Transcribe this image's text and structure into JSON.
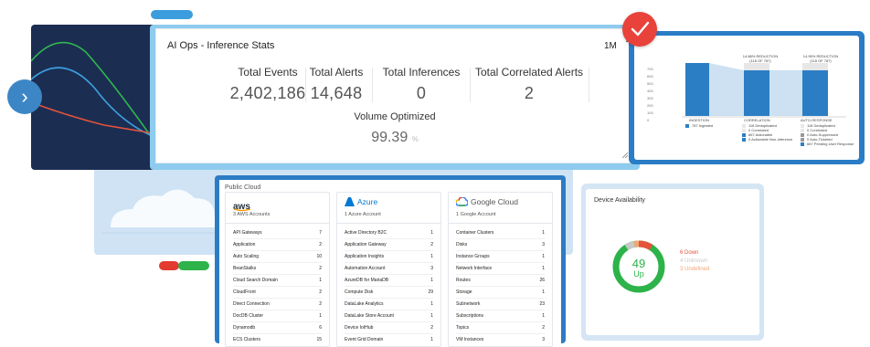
{
  "aiops": {
    "title": "AI Ops - Inference Stats",
    "range": "1M",
    "stats": [
      {
        "label": "Total Events",
        "value": "2,402,186"
      },
      {
        "label": "Total Alerts",
        "value": "14,648"
      },
      {
        "label": "Total Inferences",
        "value": "0"
      },
      {
        "label": "Total Correlated Alerts",
        "value": "2"
      }
    ],
    "volume_label": "Volume Optimized",
    "volume_value": "99.39",
    "volume_unit": "%"
  },
  "reduction": {
    "headers": [
      "14.88% REDUCTION",
      "14.95% REDUCTION"
    ],
    "subheaders": [
      "(118 OF 787)",
      "(118 OF 787)"
    ],
    "yticks": [
      "700",
      "600",
      "500",
      "400",
      "300",
      "200",
      "100",
      "0"
    ],
    "columns": [
      "INGESTION",
      "CORRELATION",
      "AUTO-RESPONSE"
    ],
    "legend_ingestion": [
      "787 Ingested"
    ],
    "legend_correlation": [
      "118 Deduplicated",
      "0 Correlated",
      "667 Actionable",
      "0 Actionable Non-Inference"
    ],
    "legend_auto": [
      "118 Deduplicated",
      "0 Correlated",
      "0 Auto-Suppressed",
      "0 Auto-Ticketed",
      "667 Pending User Response"
    ]
  },
  "public_cloud": {
    "title": "Public Cloud",
    "providers": [
      {
        "logo_text": "aws",
        "account": "3 AWS Accounts",
        "rows": [
          {
            "name": "API Gateways",
            "count": "7"
          },
          {
            "name": "Application",
            "count": "2"
          },
          {
            "name": "Auto Scaling",
            "count": "10"
          },
          {
            "name": "BeanStalks",
            "count": "2"
          },
          {
            "name": "Cloud Search Domain",
            "count": "1"
          },
          {
            "name": "CloudFront",
            "count": "2"
          },
          {
            "name": "Direct Connection",
            "count": "2"
          },
          {
            "name": "DocDB Cluster",
            "count": "1"
          },
          {
            "name": "Dynamodb",
            "count": "6"
          },
          {
            "name": "ECS Clusters",
            "count": "15"
          }
        ]
      },
      {
        "logo_text": "Azure",
        "account": "1 Azure Account",
        "rows": [
          {
            "name": "Active Directory B2C",
            "count": "1"
          },
          {
            "name": "Application Gateway",
            "count": "2"
          },
          {
            "name": "Application Insights",
            "count": "1"
          },
          {
            "name": "Automation Account",
            "count": "3"
          },
          {
            "name": "AzureDB for MariaDB",
            "count": "1"
          },
          {
            "name": "Compute Disk",
            "count": "29"
          },
          {
            "name": "DataLake Analytics",
            "count": "1"
          },
          {
            "name": "DataLake Store Account",
            "count": "1"
          },
          {
            "name": "Device IotHub",
            "count": "2"
          },
          {
            "name": "Event Grid Domain",
            "count": "1"
          }
        ]
      },
      {
        "logo_text": "Google Cloud",
        "account": "1 Google Account",
        "rows": [
          {
            "name": "Container Clusters",
            "count": "1"
          },
          {
            "name": "Disks",
            "count": "3"
          },
          {
            "name": "Instance Groups",
            "count": "1"
          },
          {
            "name": "Network Interface",
            "count": "1"
          },
          {
            "name": "Routes",
            "count": "26"
          },
          {
            "name": "Storage",
            "count": "1"
          },
          {
            "name": "Subnetwork",
            "count": "23"
          },
          {
            "name": "Subscriptions",
            "count": "1"
          },
          {
            "name": "Topics",
            "count": "2"
          },
          {
            "name": "VM Instances",
            "count": "3"
          }
        ]
      }
    ]
  },
  "device": {
    "title": "Device Availability",
    "up_count": "49",
    "up_label": "Up",
    "legend": [
      {
        "text": "6 Down",
        "color": "#e5533c"
      },
      {
        "text": "4 Unknown",
        "color": "#c8c8c8"
      },
      {
        "text": "3 Undefined",
        "color": "#f0a877"
      }
    ],
    "up_color": "#2db34a"
  },
  "colors": {
    "accent": "#2a7cc6",
    "ok": "#2db34a",
    "alert": "#e8423a"
  }
}
